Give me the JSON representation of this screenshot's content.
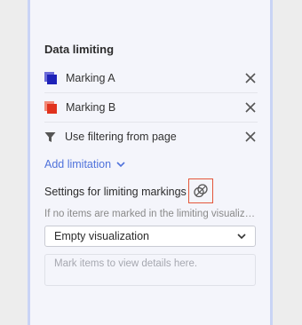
{
  "section": {
    "title": "Data limiting"
  },
  "limitations": [
    {
      "label": "Marking A",
      "icon": "marking-icon-blue",
      "color_back": "#6b6bd8",
      "color_front": "#1e22b8"
    },
    {
      "label": "Marking B",
      "icon": "marking-icon-red",
      "color_back": "#f28a78",
      "color_front": "#e0321d"
    },
    {
      "label": "Use filtering from page",
      "icon": "filter-icon"
    }
  ],
  "add_limitation": {
    "label": "Add limitation"
  },
  "settings": {
    "label": "Settings for limiting markings",
    "hint": "If no items are marked in the limiting visualization, show",
    "select_value": "Empty visualization",
    "details_placeholder": "Mark items to view details here."
  },
  "colors": {
    "accent": "#4f72db",
    "highlight": "#e4563a",
    "panel_border": "#c9d4f5"
  }
}
